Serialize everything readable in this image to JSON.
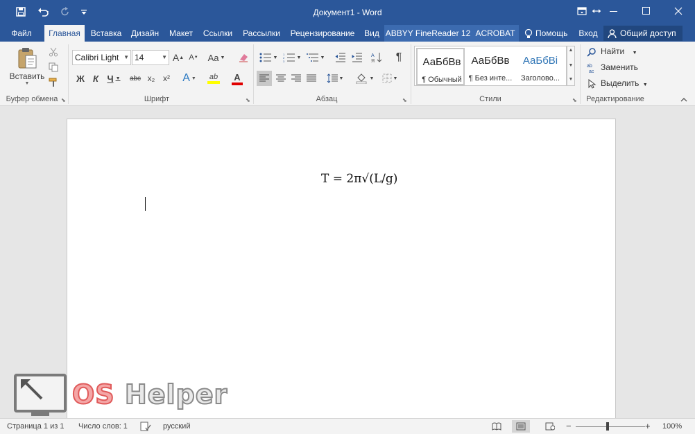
{
  "window": {
    "title": "Документ1 - Word",
    "save_icon": "save-icon",
    "undo_icon": "undo-icon",
    "redo_icon": "redo-icon"
  },
  "tabs": [
    {
      "label": "Файл"
    },
    {
      "label": "Главная",
      "active": true
    },
    {
      "label": "Вставка"
    },
    {
      "label": "Дизайн"
    },
    {
      "label": "Макет"
    },
    {
      "label": "Ссылки"
    },
    {
      "label": "Рассылки"
    },
    {
      "label": "Рецензирование"
    },
    {
      "label": "Вид"
    },
    {
      "label": "ABBYY FineReader 12"
    },
    {
      "label": "ACROBAT"
    },
    {
      "label": "Помощь"
    },
    {
      "label": "Вход"
    }
  ],
  "share": {
    "label": "Общий доступ"
  },
  "ribbon": {
    "clipboard": {
      "paste_label": "Вставить",
      "group_label": "Буфер обмена"
    },
    "font": {
      "name": "Calibri Light",
      "size": "14",
      "group_label": "Шрифт",
      "bold": "Ж",
      "italic": "К",
      "underline": "Ч",
      "strike": "abc",
      "subscript": "x₂",
      "superscript": "x²",
      "grow": "A",
      "shrink": "A",
      "case": "Aa",
      "effects": "A",
      "highlight": "ab",
      "color": "A"
    },
    "paragraph": {
      "group_label": "Абзац",
      "pilcrow": "¶"
    },
    "styles": {
      "group_label": "Стили",
      "items": [
        {
          "sample": "АаБбВв",
          "name": "¶ Обычный"
        },
        {
          "sample": "АаБбВв",
          "name": "¶ Без инте..."
        },
        {
          "sample": "АаБбВі",
          "name": "Заголово..."
        }
      ],
      "heading_color": "#2e74b5"
    },
    "editing": {
      "group_label": "Редактирование",
      "find": "Найти",
      "replace": "Заменить",
      "select": "Выделить"
    }
  },
  "document": {
    "equation": "T = 2π√(L/g)"
  },
  "watermark": {
    "brand_a": "OS",
    "brand_b": "Helper"
  },
  "status": {
    "page": "Страница 1 из 1",
    "words": "Число слов: 1",
    "language": "русский",
    "zoom": "100%",
    "zoom_fraction": 0.5
  },
  "colors": {
    "accent": "#2b579a",
    "ribbon_bg": "#f3f3f3",
    "doc_bg": "#e6e6e6"
  }
}
